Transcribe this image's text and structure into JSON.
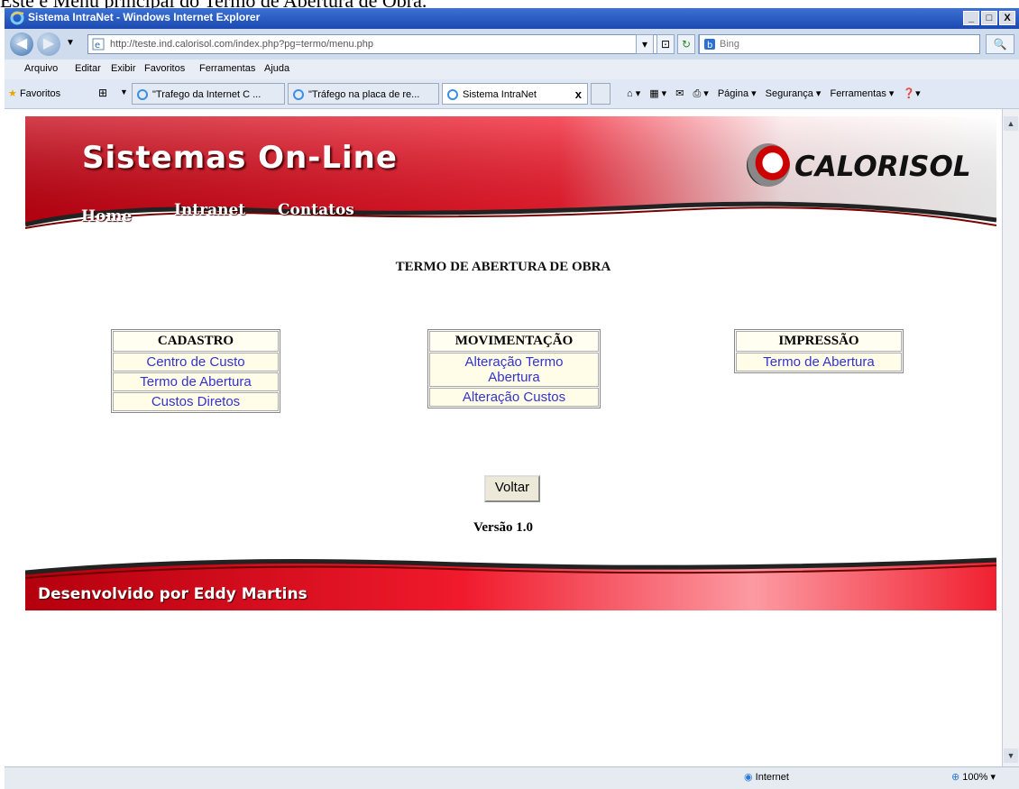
{
  "caption": "Este é Menu principal do Termo de Abertura de Obra.",
  "window": {
    "title": "Sistema IntraNet - Windows Internet Explorer",
    "min": "_",
    "max": "□",
    "close": "X"
  },
  "address": {
    "url": "http://teste.ind.calorisol.com/index.php?pg=termo/menu.php",
    "search_placeholder": "Bing",
    "back_icon": "back-arrow-icon",
    "forward_icon": "forward-arrow-icon"
  },
  "menu": [
    "Arquivo",
    "Editar",
    "Exibir",
    "Favoritos",
    "Ferramentas",
    "Ajuda"
  ],
  "favorites": {
    "label": "Favoritos",
    "tabs": [
      {
        "label": "\"Trafego da Internet C ...",
        "active": false
      },
      {
        "label": "\"Tráfego na placa de re...",
        "active": false
      },
      {
        "label": "Sistema IntraNet",
        "active": true
      }
    ],
    "commands": [
      "Página ▾",
      "Segurança ▾",
      "Ferramentas ▾"
    ]
  },
  "banner": {
    "title": "Sistemas On-Line",
    "logo": "CALORISOL",
    "nav": [
      "Home",
      "Intranet",
      "Contatos"
    ]
  },
  "page_title": "TERMO DE ABERTURA DE OBRA",
  "sections": {
    "cadastro": {
      "title": "CADASTRO",
      "items": [
        "Centro de Custo",
        "Termo de Abertura",
        "Custos Diretos"
      ]
    },
    "movimentacao": {
      "title": "MOVIMENTAÇÃO",
      "items": [
        "Alteração Termo Abertura",
        "Alteração Custos"
      ]
    },
    "impressao": {
      "title": "IMPRESSÃO",
      "items": [
        "Termo de Abertura"
      ]
    }
  },
  "voltar_label": "Voltar",
  "versao": "Versão 1.0",
  "footer": "Desenvolvido por Eddy Martins",
  "status": {
    "zone": "Internet",
    "zoom": "100%"
  },
  "colors": {
    "banner_red": "#e0111f",
    "link_blue": "#3333cc",
    "cell_bg": "#fffde8"
  }
}
